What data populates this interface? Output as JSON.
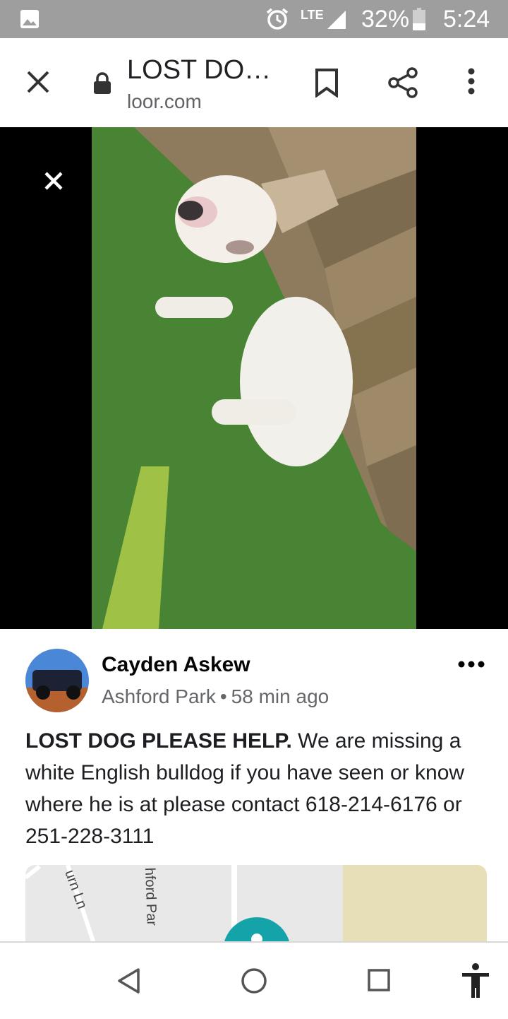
{
  "status_bar": {
    "network": "LTE",
    "battery": "32%",
    "time": "5:24",
    "icons": [
      "gallery-icon",
      "alarm-icon",
      "signal-icon",
      "battery-icon"
    ]
  },
  "browser": {
    "title": "LOST DO…",
    "url": "loor.com",
    "icons": [
      "close-icon",
      "lock-icon",
      "bookmark-icon",
      "share-icon",
      "more-vert-icon"
    ]
  },
  "post": {
    "author": "Cayden Askew",
    "location": "Ashford Park",
    "separator": "•",
    "time_ago": "58 min ago",
    "body_lead": "LOST DOG PLEASE HELP.",
    "body_rest": " We are missing a white English bulldog if you have seen or know where he is at please contact 618-214-6176 or 251-228-3111",
    "map_labels": {
      "street1": "urn Ln",
      "street2": "hford Par"
    }
  },
  "colors": {
    "status_bar": "#9e9e9e",
    "map_accent": "#14a3a8",
    "map_park": "#e6dfb8"
  }
}
